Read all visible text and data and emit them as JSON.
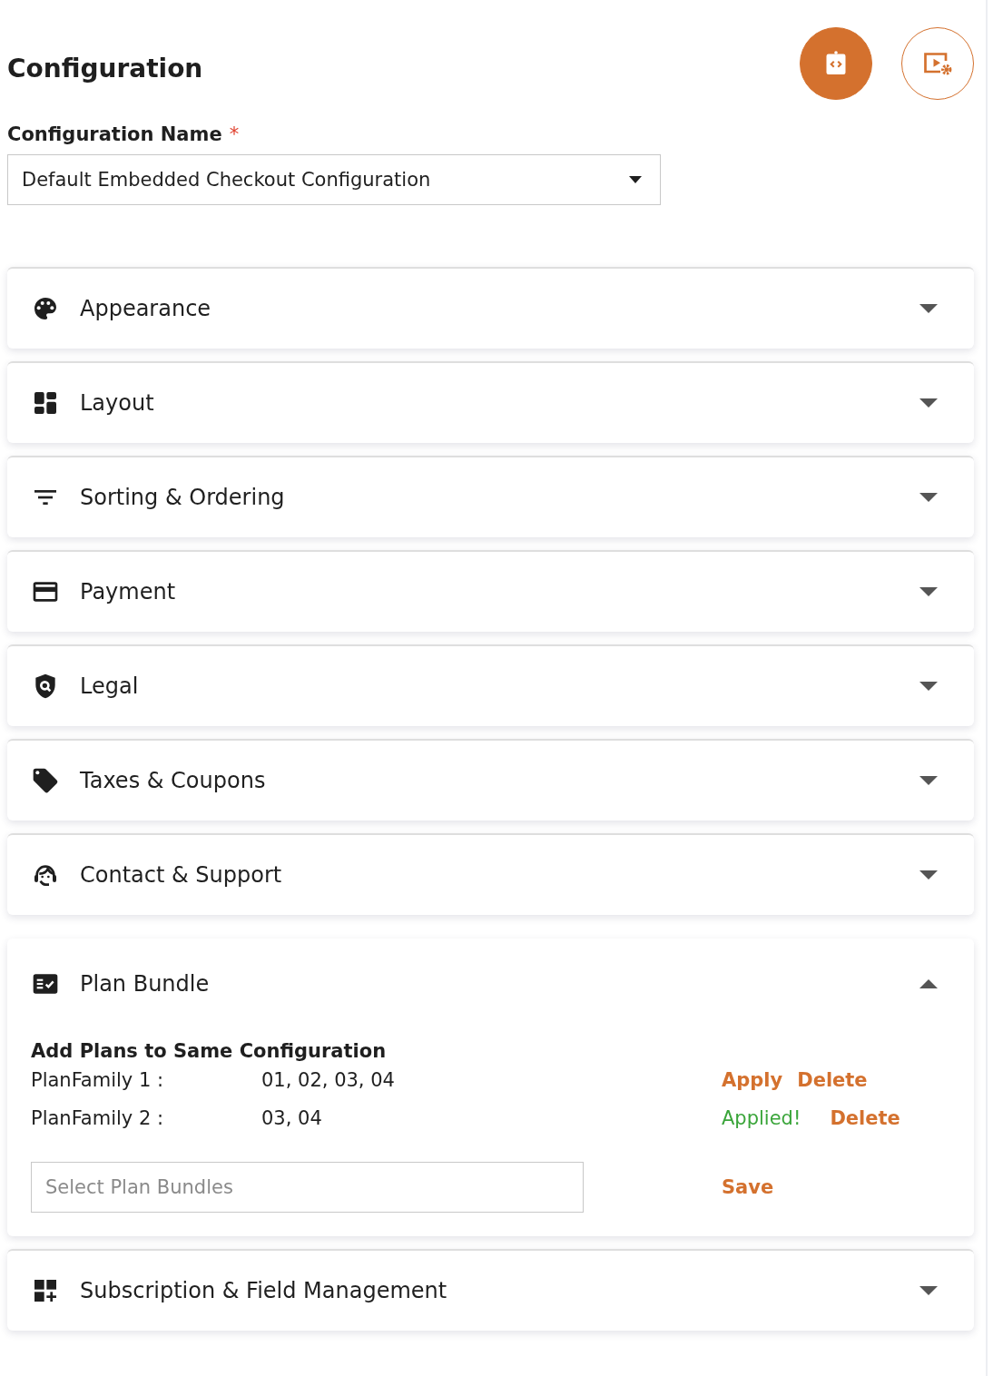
{
  "header": {
    "title": "Configuration",
    "actions": [
      {
        "kind": "embed",
        "filled": true
      },
      {
        "kind": "preview",
        "filled": false
      }
    ]
  },
  "config_name": {
    "label": "Configuration Name",
    "required_mark": "*",
    "value": "Default Embedded Checkout Configuration"
  },
  "sections": [
    {
      "kind": "palette",
      "title": "Appearance",
      "expanded": false
    },
    {
      "kind": "dashboard",
      "title": "Layout",
      "expanded": false
    },
    {
      "kind": "filter",
      "title": "Sorting & Ordering",
      "expanded": false
    },
    {
      "kind": "card",
      "title": "Payment",
      "expanded": false
    },
    {
      "kind": "shield",
      "title": "Legal",
      "expanded": false
    },
    {
      "kind": "tag",
      "title": "Taxes & Coupons",
      "expanded": false
    },
    {
      "kind": "headset",
      "title": "Contact & Support",
      "expanded": false
    },
    {
      "kind": "checklist",
      "title": "Plan Bundle",
      "expanded": true,
      "content": {
        "heading": "Add Plans to Same Configuration",
        "families": [
          {
            "label": "PlanFamily 1 :",
            "plans": "01, 02, 03, 04",
            "actions": [
              {
                "kind": "link",
                "label": "Apply"
              },
              {
                "kind": "link",
                "label": "Delete"
              }
            ]
          },
          {
            "label": "PlanFamily 2 :",
            "plans": "03, 04",
            "actions": [
              {
                "kind": "status",
                "label": "Applied!"
              },
              {
                "kind": "link",
                "label": "Delete"
              }
            ]
          }
        ],
        "input": {
          "placeholder": "Select Plan Bundles"
        },
        "save_button": "Save"
      }
    },
    {
      "kind": "grid-plus",
      "title": "Subscription & Field Management",
      "expanded": false
    }
  ]
}
